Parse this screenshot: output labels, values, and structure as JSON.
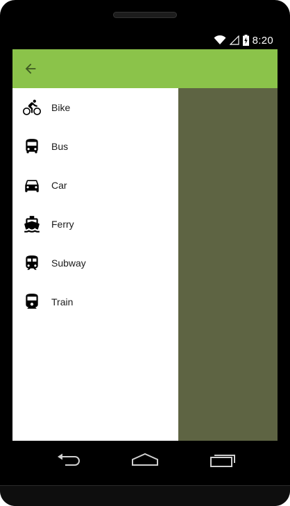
{
  "status_bar": {
    "time": "8:20",
    "icons": [
      "wifi-icon",
      "cell-signal-icon",
      "battery-charging-icon"
    ]
  },
  "toolbar": {
    "back_icon": "arrow-back-icon",
    "color": "#8bc34a"
  },
  "drawer": {
    "items": [
      {
        "label": "Bike",
        "icon": "bike-icon"
      },
      {
        "label": "Bus",
        "icon": "bus-icon"
      },
      {
        "label": "Car",
        "icon": "car-icon"
      },
      {
        "label": "Ferry",
        "icon": "ferry-icon"
      },
      {
        "label": "Subway",
        "icon": "subway-icon"
      },
      {
        "label": "Train",
        "icon": "train-icon"
      }
    ]
  },
  "nav_bar": {
    "icons": [
      "back-nav-icon",
      "home-nav-icon",
      "recents-nav-icon"
    ]
  },
  "colors": {
    "accent": "#8bc34a",
    "scrim": "#5e6443",
    "drawer_bg": "#ffffff"
  }
}
